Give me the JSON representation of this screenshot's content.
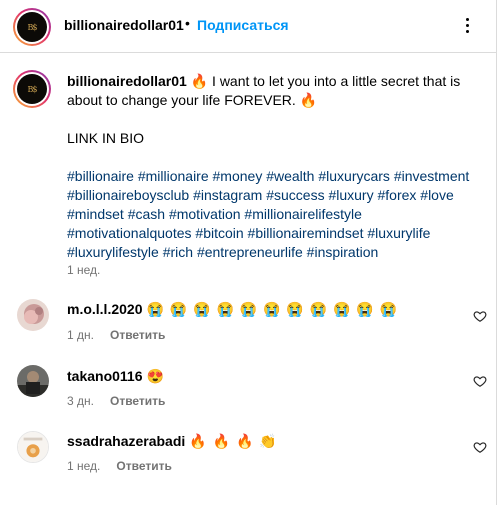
{
  "header": {
    "username": "billionairedollar01",
    "dot": "•",
    "subscribe_label": "Подписаться",
    "more_icon": "more-horizontal-icon"
  },
  "logo_text": "B$",
  "caption": {
    "username": "billionairedollar01",
    "text_part1": " 🔥 I want to let you into a little secret that is about to change your life FOREVER. 🔥",
    "link_in_bio": "LINK IN BIO",
    "hashtags": "#billionaire #millionaire #money #wealth #luxurycars #investment #billionaireboysclub #instagram #success #luxury #forex #love #mindset #cash #motivation #millionairelifestyle #motivationalquotes #bitcoin #billionairemindset #luxurylife #luxurylifestyle #rich #entrepreneurlife #inspiration",
    "time": "1 нед."
  },
  "comments": [
    {
      "username": "m.o.l.l.2020",
      "text": "😭 😭 😭 😭 😭 😭 😭 😭 😭 😭 😭",
      "time": "1 дн.",
      "reply_label": "Ответить"
    },
    {
      "username": "takano0116",
      "text": "😍",
      "time": "3 дн.",
      "reply_label": "Ответить"
    },
    {
      "username": "ssadrahazerabadi",
      "text": "🔥 🔥 🔥 👏",
      "time": "1 нед.",
      "reply_label": "Ответить"
    }
  ],
  "colors": {
    "accent": "#0095f6",
    "hashtag": "#00376b",
    "secondary": "#737373",
    "border": "#dbdbdb"
  }
}
